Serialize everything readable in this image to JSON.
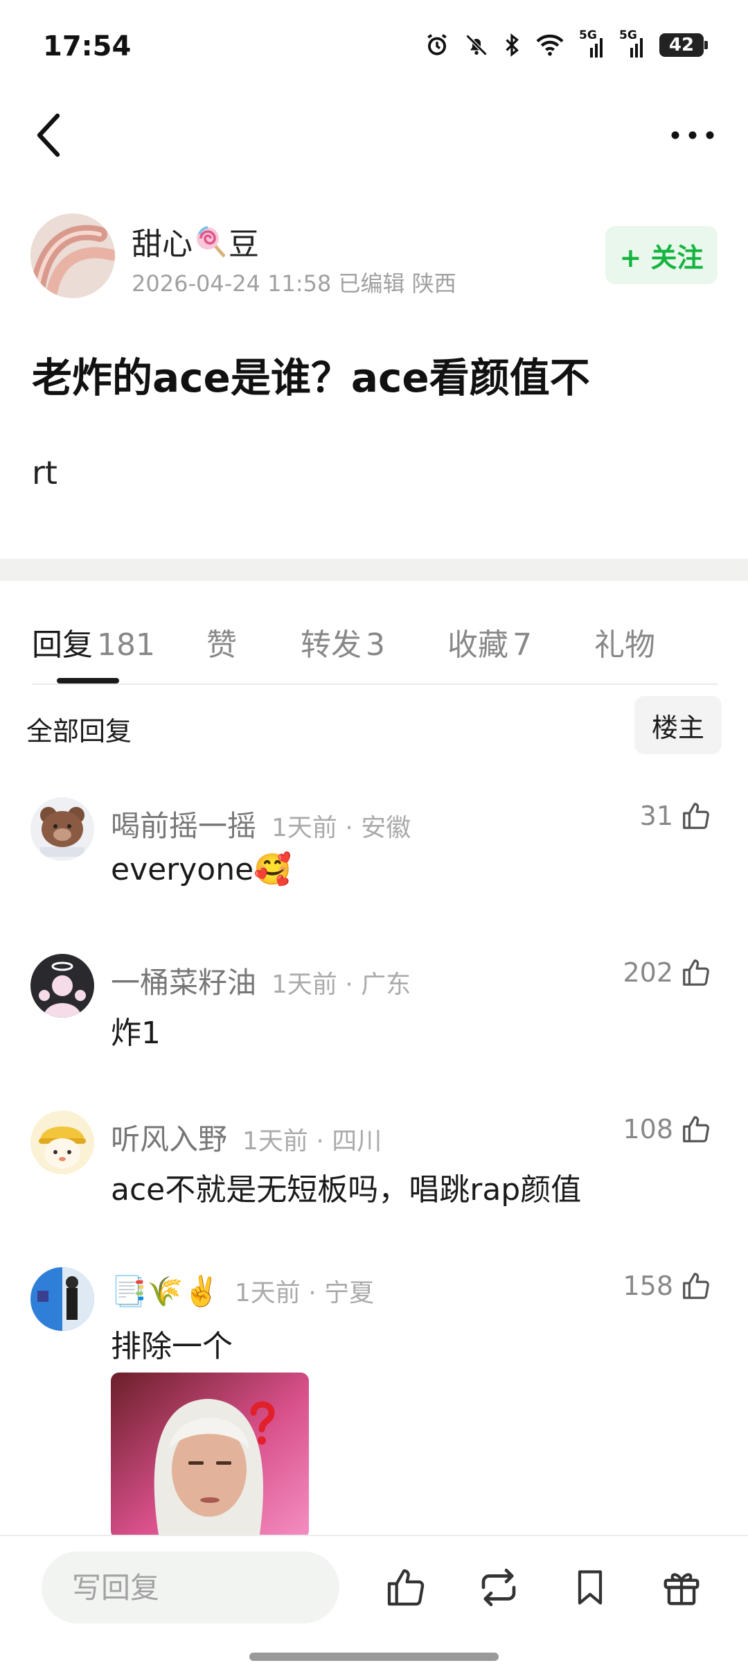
{
  "status_bar": {
    "time": "17:54",
    "network_1": "5G",
    "network_2": "5G",
    "battery": "42"
  },
  "nav": {
    "back_icon": "chevron-left-icon",
    "more_icon": "more-horizontal-icon"
  },
  "post": {
    "author": {
      "name_prefix": "甜心",
      "name_suffix": "豆",
      "name_emoji": "lollipop",
      "meta": "2026-04-24 11:58  已编辑  陕西"
    },
    "follow_label": "+ 关注",
    "title": "老炸的ace是谁？ace看颜值不",
    "body": "rt"
  },
  "tabs": [
    {
      "label": "回复",
      "count": "181",
      "active": true
    },
    {
      "label": "赞",
      "count": "",
      "active": false
    },
    {
      "label": "转发",
      "count": "3",
      "active": false
    },
    {
      "label": "收藏",
      "count": "7",
      "active": false
    },
    {
      "label": "礼物",
      "count": "",
      "active": false
    }
  ],
  "filter": {
    "all_label": "全部回复",
    "owner_label": "楼主"
  },
  "comments": [
    {
      "name": "喝前摇一摇",
      "meta": "1天前 · 安徽",
      "likes": "31",
      "text": "everyone🥰"
    },
    {
      "name": "一桶菜籽油",
      "meta": "1天前 · 广东",
      "likes": "202",
      "text": "炸1"
    },
    {
      "name": "听风入野",
      "meta": "1天前 · 四川",
      "likes": "108",
      "text": "ace不就是无短板吗，唱跳rap颜值"
    },
    {
      "name": "📑🌾✌️",
      "meta": "1天前 · 宁夏",
      "likes": "158",
      "text": "排除一个"
    }
  ],
  "bottom_bar": {
    "reply_placeholder": "写回复",
    "icons": [
      "thumbs-up-icon",
      "repost-icon",
      "bookmark-icon",
      "gift-icon"
    ]
  },
  "colors": {
    "accent_green": "#15b440",
    "follow_bg": "#eaf7ec"
  }
}
